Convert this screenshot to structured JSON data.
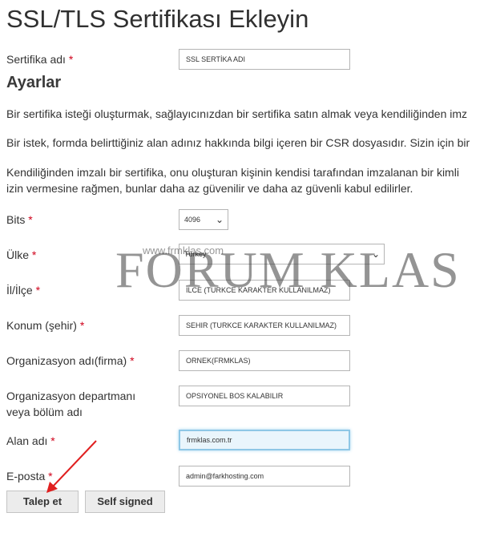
{
  "page": {
    "title": "SSL/TLS Sertifikası Ekleyin",
    "section_title": "Ayarlar",
    "paragraphs": [
      "Bir sertifika isteği oluşturmak, sağlayıcınızdan bir sertifika satın almak veya kendiliğinden imz",
      "Bir istek, formda belirttiğiniz alan adınız hakkında bilgi içeren bir CSR dosyasıdır. Sizin için bir",
      "Kendiliğinden imzalı bir sertifika, onu oluşturan kişinin kendisi tarafından imzalanan bir kimli",
      "izin vermesine rağmen, bunlar daha az güvenilir ve daha az güvenli kabul edilirler."
    ],
    "required_mark": "*"
  },
  "form": {
    "cert_name": {
      "label": "Sertifika adı",
      "value": "SSL SERTİKA ADI"
    },
    "bits": {
      "label": "Bits",
      "value": "4096"
    },
    "country": {
      "label": "Ülke",
      "value": "Türkey"
    },
    "province": {
      "label": "İl/İlçe",
      "value": "ILCE (TURKCE KARAKTER KULLANILMAZ)"
    },
    "city": {
      "label": "Konum (şehir)",
      "value": "SEHIR (TURKCE KARAKTER KULLANILMAZ)"
    },
    "organization": {
      "label": "Organizasyon adı(firma)",
      "value": "ORNEK(FRMKLAS)"
    },
    "department": {
      "label": "Organizasyon departmanı veya bölüm adı",
      "value": "OPSIYONEL BOS KALABILIR"
    },
    "domain": {
      "label": "Alan adı",
      "value": "frmklas.com.tr"
    },
    "email": {
      "label": "E-posta",
      "value": "admin@farkhosting.com"
    }
  },
  "buttons": {
    "request": "Talep et",
    "self_signed": "Self signed"
  },
  "watermark": {
    "text": "FORUM KLAS",
    "url": "www.frmklas.com"
  },
  "colors": {
    "required": "#d0021b",
    "focus_border": "#8ec7e6",
    "arrow": "#e02020"
  }
}
